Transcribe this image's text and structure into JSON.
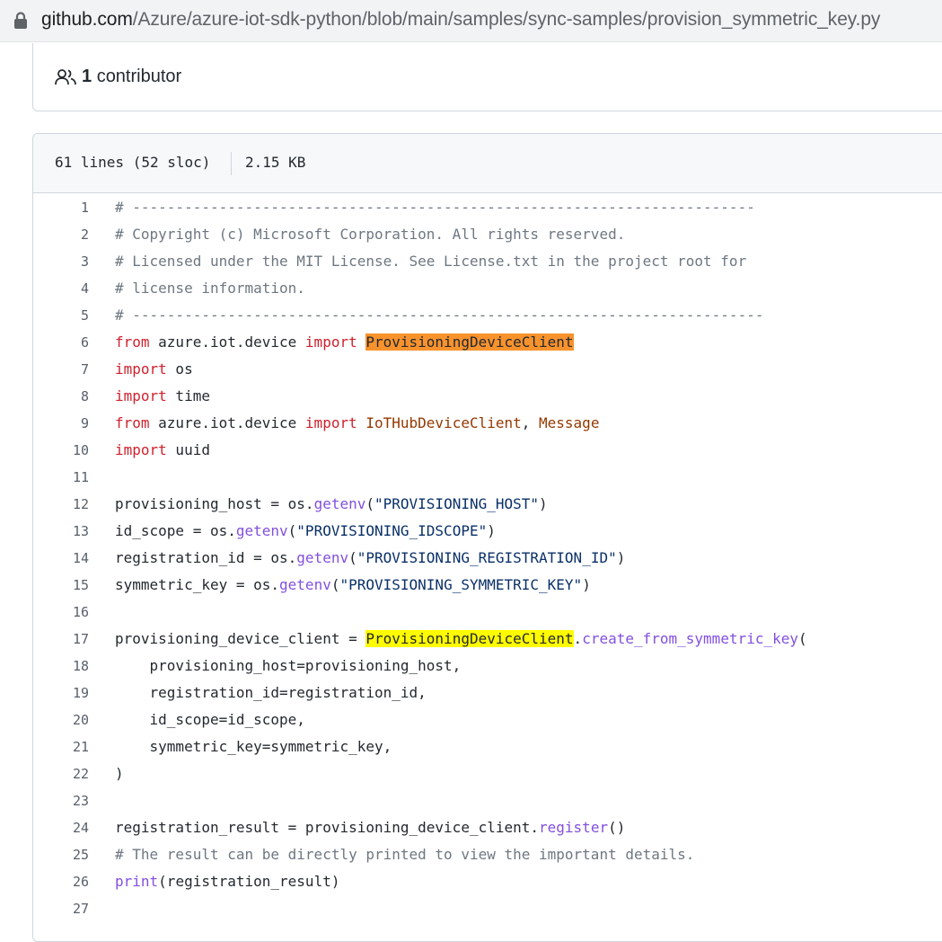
{
  "address_bar": {
    "domain": "github.com",
    "path": "/Azure/azure-iot-sdk-python/blob/main/samples/sync-samples/provision_symmetric_key.py"
  },
  "contributors": {
    "count": "1",
    "label": "contributor"
  },
  "file_header": {
    "lines": "61 lines (52 sloc)",
    "size": "2.15 KB"
  },
  "code_lines": [
    {
      "n": "1",
      "tokens": [
        {
          "t": "# ------------------------------------------------------------------------",
          "c": "cm"
        }
      ]
    },
    {
      "n": "2",
      "tokens": [
        {
          "t": "# Copyright (c) Microsoft Corporation. All rights reserved.",
          "c": "cm"
        }
      ]
    },
    {
      "n": "3",
      "tokens": [
        {
          "t": "# Licensed under the MIT License. See License.txt in the project root for",
          "c": "cm"
        }
      ]
    },
    {
      "n": "4",
      "tokens": [
        {
          "t": "# license information.",
          "c": "cm"
        }
      ]
    },
    {
      "n": "5",
      "tokens": [
        {
          "t": "# -------------------------------------------------------------------------",
          "c": "cm"
        }
      ]
    },
    {
      "n": "6",
      "tokens": [
        {
          "t": "from",
          "c": "kw"
        },
        {
          "t": " azure.iot.device "
        },
        {
          "t": "import",
          "c": "kw"
        },
        {
          "t": " "
        },
        {
          "t": "ProvisioningDeviceClient",
          "c": "hlo"
        }
      ]
    },
    {
      "n": "7",
      "tokens": [
        {
          "t": "import",
          "c": "kw"
        },
        {
          "t": " os"
        }
      ]
    },
    {
      "n": "8",
      "tokens": [
        {
          "t": "import",
          "c": "kw"
        },
        {
          "t": " time"
        }
      ]
    },
    {
      "n": "9",
      "tokens": [
        {
          "t": "from",
          "c": "kw"
        },
        {
          "t": " azure.iot.device "
        },
        {
          "t": "import",
          "c": "kw"
        },
        {
          "t": " "
        },
        {
          "t": "IoTHubDeviceClient",
          "c": "cls"
        },
        {
          "t": ", "
        },
        {
          "t": "Message",
          "c": "cls"
        }
      ]
    },
    {
      "n": "10",
      "tokens": [
        {
          "t": "import",
          "c": "kw"
        },
        {
          "t": " uuid"
        }
      ]
    },
    {
      "n": "11",
      "tokens": []
    },
    {
      "n": "12",
      "tokens": [
        {
          "t": "provisioning_host = os."
        },
        {
          "t": "getenv",
          "c": "fn"
        },
        {
          "t": "("
        },
        {
          "t": "\"PROVISIONING_HOST\"",
          "c": "st"
        },
        {
          "t": ")"
        }
      ]
    },
    {
      "n": "13",
      "tokens": [
        {
          "t": "id_scope = os."
        },
        {
          "t": "getenv",
          "c": "fn"
        },
        {
          "t": "("
        },
        {
          "t": "\"PROVISIONING_IDSCOPE\"",
          "c": "st"
        },
        {
          "t": ")"
        }
      ]
    },
    {
      "n": "14",
      "tokens": [
        {
          "t": "registration_id = os."
        },
        {
          "t": "getenv",
          "c": "fn"
        },
        {
          "t": "("
        },
        {
          "t": "\"PROVISIONING_REGISTRATION_ID\"",
          "c": "st"
        },
        {
          "t": ")"
        }
      ]
    },
    {
      "n": "15",
      "tokens": [
        {
          "t": "symmetric_key = os."
        },
        {
          "t": "getenv",
          "c": "fn"
        },
        {
          "t": "("
        },
        {
          "t": "\"PROVISIONING_SYMMETRIC_KEY\"",
          "c": "st"
        },
        {
          "t": ")"
        }
      ]
    },
    {
      "n": "16",
      "tokens": []
    },
    {
      "n": "17",
      "tokens": [
        {
          "t": "provisioning_device_client = "
        },
        {
          "t": "ProvisioningDeviceClient",
          "c": "hly"
        },
        {
          "t": "."
        },
        {
          "t": "create_from_symmetric_key",
          "c": "fn"
        },
        {
          "t": "("
        }
      ]
    },
    {
      "n": "18",
      "tokens": [
        {
          "t": "    provisioning_host=provisioning_host,"
        }
      ]
    },
    {
      "n": "19",
      "tokens": [
        {
          "t": "    registration_id=registration_id,"
        }
      ]
    },
    {
      "n": "20",
      "tokens": [
        {
          "t": "    id_scope=id_scope,"
        }
      ]
    },
    {
      "n": "21",
      "tokens": [
        {
          "t": "    symmetric_key=symmetric_key,"
        }
      ]
    },
    {
      "n": "22",
      "tokens": [
        {
          "t": ")"
        }
      ]
    },
    {
      "n": "23",
      "tokens": []
    },
    {
      "n": "24",
      "tokens": [
        {
          "t": "registration_result = provisioning_device_client."
        },
        {
          "t": "register",
          "c": "fn"
        },
        {
          "t": "()"
        }
      ]
    },
    {
      "n": "25",
      "tokens": [
        {
          "t": "# The result can be directly printed to view the important details.",
          "c": "cm"
        }
      ]
    },
    {
      "n": "26",
      "tokens": [
        {
          "t": "print",
          "c": "fn"
        },
        {
          "t": "(registration_result)"
        }
      ]
    },
    {
      "n": "27",
      "tokens": []
    }
  ],
  "icons": {
    "lock": "lock-icon",
    "people": "people-icon"
  },
  "colors": {
    "keyword": "#cf222e",
    "comment": "#6e7781",
    "function": "#8250df",
    "string": "#0a3069",
    "class": "#953800",
    "highlight_orange": "#f7922d",
    "highlight_yellow": "#fffb00"
  }
}
